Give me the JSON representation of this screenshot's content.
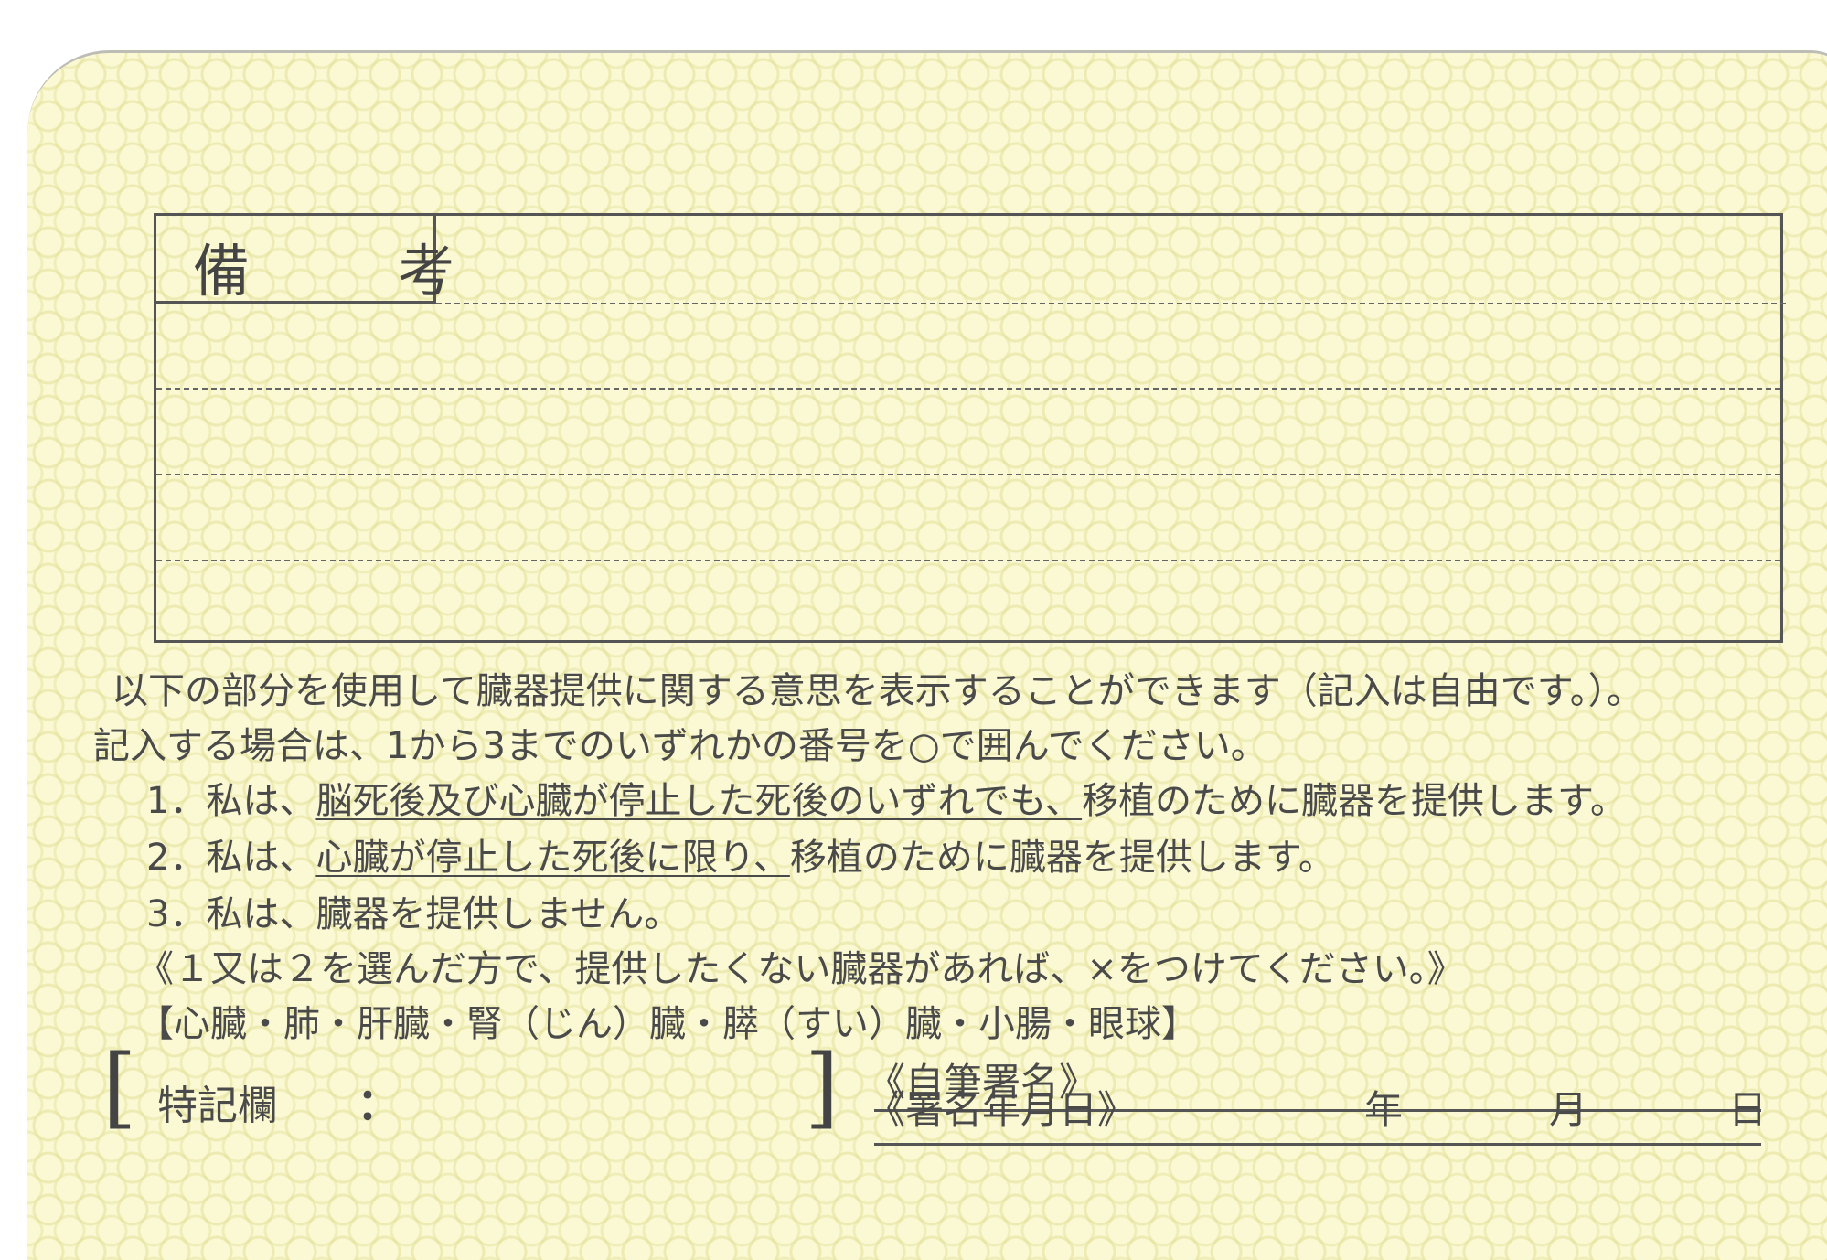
{
  "remarks": {
    "title": "備　考"
  },
  "intro": {
    "line1": "以下の部分を使用して臓器提供に関する意思を表示することができます（記入は自由です。）。",
    "line2": "記入する場合は、1から3までのいずれかの番号を○で囲んでください。"
  },
  "options": [
    {
      "number": "1．",
      "prefix": "私は、",
      "underlined": "脳死後及び心臓が停止した死後のいずれでも、",
      "suffix": "移植のために臓器を提供します。"
    },
    {
      "number": "2．",
      "prefix": "私は、",
      "underlined": "心臓が停止した死後に限り、",
      "suffix": "移植のために臓器を提供します。"
    },
    {
      "number": "3．",
      "prefix": "私は、",
      "underlined": "",
      "suffix": "臓器を提供しません。"
    }
  ],
  "note": "《１又は２を選んだ方で、提供したくない臓器があれば、×をつけてください。》",
  "organs": "【心臓・肺・肝臓・腎（じん）臓・膵（すい）臓・小腸・眼球】",
  "special": {
    "label": "特記欄",
    "colon": "："
  },
  "signature": {
    "label": "《自筆署名》",
    "date_label": "《署名年月日》",
    "year": "年",
    "month": "月",
    "day": "日"
  },
  "colors": {
    "background": "#fbf9d4",
    "pattern": "#e2df96",
    "ink": "#4a4a4a"
  }
}
